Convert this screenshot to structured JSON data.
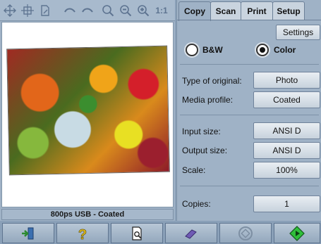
{
  "toolbar": {
    "icons": [
      "fit-icon",
      "move-icon",
      "page-icon",
      "undo-icon",
      "redo-icon",
      "zoom-icon",
      "zoom-out-icon",
      "zoom-in-icon",
      "actual-size-icon"
    ],
    "actual_size_label": "1:1"
  },
  "preview": {
    "status": "800ps USB - Coated"
  },
  "tabs": [
    {
      "label": "Copy",
      "active": true
    },
    {
      "label": "Scan",
      "active": false
    },
    {
      "label": "Print",
      "active": false
    },
    {
      "label": "Setup",
      "active": false
    }
  ],
  "copy_panel": {
    "settings_label": "Settings",
    "color_mode": {
      "bw_label": "B&W",
      "color_label": "Color",
      "selected": "Color"
    },
    "type_of_original": {
      "label": "Type of original:",
      "value": "Photo"
    },
    "media_profile": {
      "label": "Media profile:",
      "value": "Coated"
    },
    "input_size": {
      "label": "Input size:",
      "value": "ANSI D"
    },
    "output_size": {
      "label": "Output size:",
      "value": "ANSI D"
    },
    "scale": {
      "label": "Scale:",
      "value": "100%"
    },
    "copies": {
      "label": "Copies:",
      "value": "1"
    }
  },
  "bottom_bar": {
    "icons": [
      "exit-icon",
      "help-icon",
      "preview-icon",
      "eraser-icon",
      "stop-icon",
      "start-icon"
    ]
  },
  "colors": {
    "panel_bg": "#9fb2c6",
    "start_green": "#2fbf3a",
    "help_yellow": "#e5c01b"
  }
}
